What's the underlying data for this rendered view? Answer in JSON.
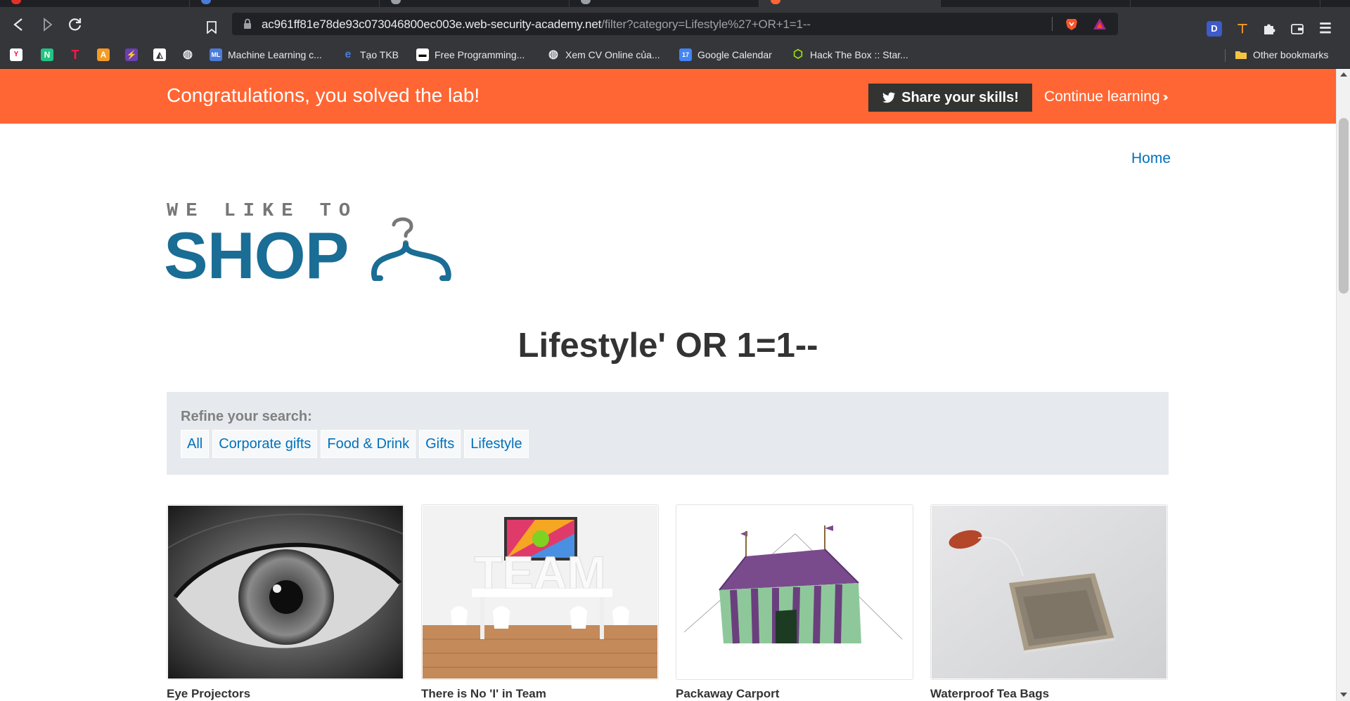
{
  "browser": {
    "url_host": "ac961ff81e78de93c073046800ec003e.web-security-academy.net",
    "url_path": "/filter?category=Lifestyle%27+OR+1=1--",
    "bookmarks": [
      {
        "label": "",
        "icon": "ycombinator-icon",
        "color": "#ff0033"
      },
      {
        "label": "",
        "icon": "n-icon",
        "color": "#23c483"
      },
      {
        "label": "",
        "icon": "t-icon",
        "color": "#ff1744"
      },
      {
        "label": "",
        "icon": "a-icon",
        "color": "#f59b23"
      },
      {
        "label": "",
        "icon": "bolt-icon",
        "color": "#6b3fb5"
      },
      {
        "label": "",
        "icon": "origami-icon",
        "color": "#ffffff"
      },
      {
        "label": "",
        "icon": "globe-icon",
        "color": "#e8eaed"
      },
      {
        "label": "Machine Learning c...",
        "icon": "ml-icon",
        "color": "#4a7bd9"
      },
      {
        "label": "Tạo TKB",
        "icon": "ie-icon",
        "color": "#4a7bd9"
      },
      {
        "label": "Free Programming...",
        "icon": "fcc-icon",
        "color": "#ffffff"
      },
      {
        "label": "Xem CV Online của...",
        "icon": "globe-icon",
        "color": "#e8eaed"
      },
      {
        "label": "Google Calendar",
        "icon": "calendar-icon",
        "color": "#4285f4"
      },
      {
        "label": "Hack The Box :: Star...",
        "icon": "cube-icon",
        "color": "#9fef00"
      }
    ],
    "other_bookmarks": "Other bookmarks"
  },
  "banner": {
    "message": "Congratulations, you solved the lab!",
    "share_label": "Share your skills!",
    "continue_label": "Continue learning"
  },
  "nav": {
    "home": "Home"
  },
  "logo": {
    "tagline": "WE LIKE TO",
    "brand": "SHOP"
  },
  "page_title": "Lifestyle' OR 1=1--",
  "filter": {
    "label": "Refine your search:",
    "categories": [
      "All",
      "Corporate gifts",
      "Food & Drink",
      "Gifts",
      "Lifestyle"
    ]
  },
  "products": [
    {
      "name": "Eye Projectors",
      "image": "eye-image"
    },
    {
      "name": "There is No 'I' in Team",
      "image": "team-image"
    },
    {
      "name": "Packaway Carport",
      "image": "tent-image"
    },
    {
      "name": "Waterproof Tea Bags",
      "image": "teabag-image"
    }
  ],
  "colors": {
    "banner": "#ff6633",
    "accent": "#0071bc",
    "logo": "#1a6d94",
    "share_button": "#333332",
    "filter_bg": "#e6eaee"
  }
}
